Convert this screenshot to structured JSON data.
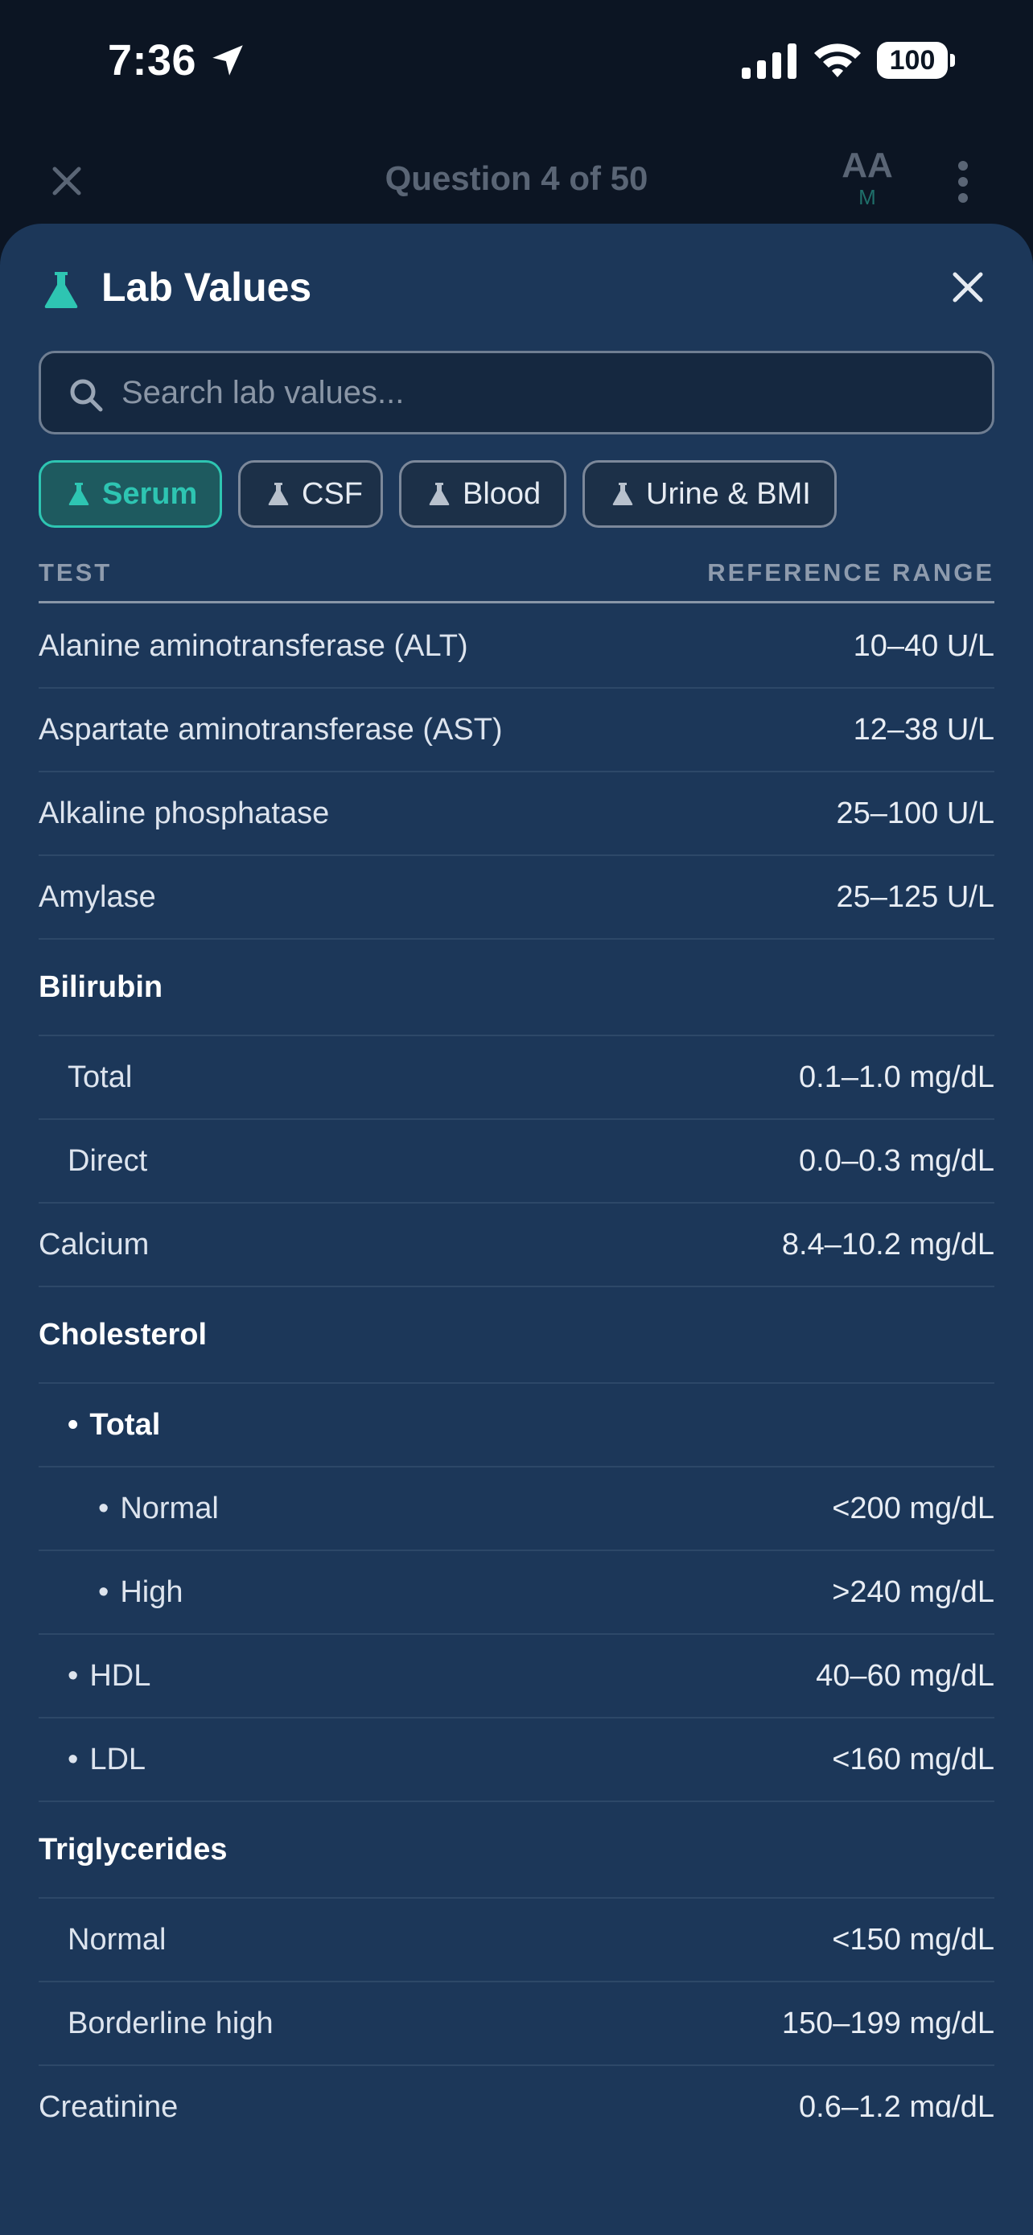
{
  "status_bar": {
    "time": "7:36",
    "battery": "100"
  },
  "nav": {
    "title": "Question 4 of 50",
    "font_size_label": "AA",
    "font_size_level": "M"
  },
  "sheet": {
    "title": "Lab Values",
    "search_placeholder": "Search lab values...",
    "tabs": [
      {
        "label": "Serum",
        "active": true
      },
      {
        "label": "CSF",
        "active": false
      },
      {
        "label": "Blood",
        "active": false
      },
      {
        "label": "Urine & BMI",
        "active": false
      }
    ],
    "table": {
      "col_test": "TEST",
      "col_range": "REFERENCE RANGE",
      "rows": [
        {
          "name": "Alanine aminotransferase (ALT)",
          "value": "10–40 U/L"
        },
        {
          "name": "Aspartate aminotransferase (AST)",
          "value": "12–38 U/L"
        },
        {
          "name": "Alkaline phosphatase",
          "value": "25–100 U/L"
        },
        {
          "name": "Amylase",
          "value": "25–125 U/L"
        },
        {
          "name": "Bilirubin",
          "value": ""
        },
        {
          "name": "Total",
          "value": "0.1–1.0 mg/dL"
        },
        {
          "name": "Direct",
          "value": "0.0–0.3 mg/dL"
        },
        {
          "name": "Calcium",
          "value": "8.4–10.2 mg/dL"
        },
        {
          "name": "Cholesterol",
          "value": ""
        },
        {
          "name": "Total",
          "value": ""
        },
        {
          "name": "Normal",
          "value": "<200 mg/dL"
        },
        {
          "name": "High",
          "value": ">240 mg/dL"
        },
        {
          "name": "HDL",
          "value": "40–60 mg/dL"
        },
        {
          "name": "LDL",
          "value": "<160 mg/dL"
        },
        {
          "name": "Triglycerides",
          "value": ""
        },
        {
          "name": "Normal",
          "value": "<150 mg/dL"
        },
        {
          "name": "Borderline high",
          "value": "150–199 mg/dL"
        },
        {
          "name": "Creatinine",
          "value": "0.6–1.2 mg/dL"
        }
      ]
    }
  },
  "colors": {
    "accent": "#2ec5b2",
    "sheet_bg": "#1c3759",
    "page_bg": "#0c1523"
  }
}
